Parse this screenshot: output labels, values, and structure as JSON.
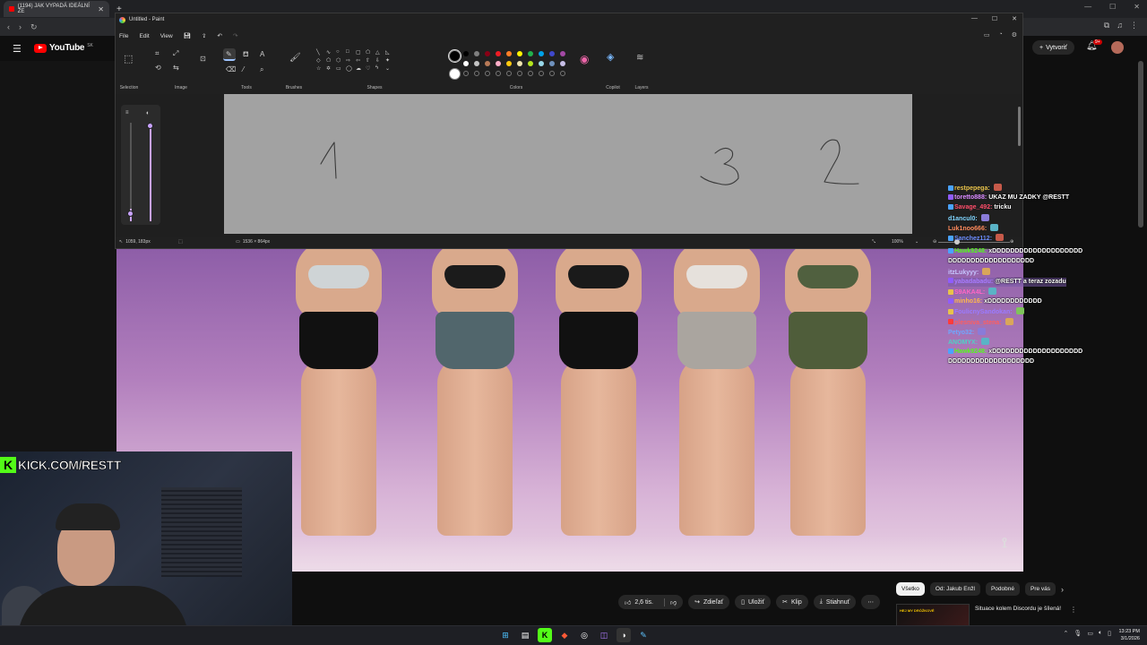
{
  "browser": {
    "tab_title": "(1194) JAK VYPADÁ IDEÁLNÍ ŽE",
    "tab_close": "✕",
    "new_tab": "+"
  },
  "youtube": {
    "logo_text": "YouTube",
    "region": "SK",
    "create_label": "Vytvoriť",
    "notif_count": "9+",
    "actions": {
      "like_count": "2,6 tis.",
      "share": "Zdieľať",
      "save": "Uložiť",
      "clip": "Klip",
      "download": "Stiahnuť"
    },
    "chips": [
      "Všetko",
      "Od: Jakub Enžl",
      "Podobné",
      "Pre vás"
    ],
    "recommended": {
      "thumb_text": "HEJ MY DRÓŽKOVÉ",
      "title": "Situace kolem Discordu je šílená!"
    }
  },
  "webcam": {
    "kick_label": "KICK.COM/RESTT"
  },
  "paint": {
    "window_title": "Untitled - Paint",
    "menu": [
      "File",
      "Edit",
      "View"
    ],
    "ribbon_groups": {
      "selection": "Selection",
      "image": "Image",
      "tools": "Tools",
      "brushes": "Brushes",
      "shapes": "Shapes",
      "colors": "Colors",
      "copilot": "Copilot",
      "layers": "Layers"
    },
    "colors": {
      "primary": "#000000",
      "secondary": "#ffffff",
      "palette_row1": [
        "#000000",
        "#7f7f7f",
        "#880015",
        "#ed1c24",
        "#ff7f27",
        "#fff200",
        "#22b14c",
        "#00a2e8",
        "#3f48cc",
        "#a349a4"
      ],
      "palette_row2": [
        "#ffffff",
        "#c3c3c3",
        "#b97a57",
        "#ffaec9",
        "#ffc90e",
        "#efe4b0",
        "#b5e61d",
        "#99d9ea",
        "#7092be",
        "#c8bfe7"
      ]
    },
    "canvas_numbers": [
      "1",
      "3",
      "2"
    ],
    "status": {
      "cursor_pos": "1059, 183px",
      "canvas_size": "1536 × 864px",
      "zoom": "100%"
    }
  },
  "chat": [
    {
      "user": "restpepega:",
      "user_color": "#e8c24a",
      "text": "",
      "badge": "#4aa3ff"
    },
    {
      "user": "toretto888:",
      "user_color": "#d98aff",
      "text": "UKAZ MU ZADKY @RESTT",
      "badge": "#8f5cff"
    },
    {
      "user": "Savage_492:",
      "user_color": "#ff4d6a",
      "text": "tricku",
      "badge": "#4aa3ff"
    },
    {
      "user": "d1ancul0:",
      "user_color": "#7fd4ff",
      "text": "",
      "badge": ""
    },
    {
      "user": "Luk1noo666:",
      "user_color": "#ff8a5c",
      "text": "",
      "badge": ""
    },
    {
      "user": "Sanchez112:",
      "user_color": "#6b8cff",
      "text": "",
      "badge": "#4aa3ff"
    },
    {
      "user": "Hawk9248:",
      "user_color": "#53fc18",
      "text": "xDDDDDDDDDDDDDDDDDDDD",
      "text2": "DDDDDDDDDDDDDDDDDDD",
      "badge": "#4aa3ff"
    },
    {
      "user": "itzLukyyy:",
      "user_color": "#c6c6ff",
      "text": "",
      "badge": ""
    },
    {
      "user": "yabadabadu:",
      "user_color": "#a77bff",
      "text": "@RESTT a teraz zozadu",
      "badge": "#8f5cff"
    },
    {
      "user": "S9AKA4L:",
      "user_color": "#ff66c4",
      "text": "",
      "badge": "#e8c24a"
    },
    {
      "user": "minho16:",
      "user_color": "#ffb84d",
      "text": "xDDDDDDDDDDDD",
      "badge": "#8f5cff"
    },
    {
      "user": "FoulicnySandokan:",
      "user_color": "#9a7bff",
      "text": "",
      "badge": "#e8c24a"
    },
    {
      "user": "plesniva_stena:",
      "user_color": "#ff5e5e",
      "text": "",
      "badge": "#ff3b3b"
    },
    {
      "user": "Petyo32:",
      "user_color": "#6ea8ff",
      "text": "",
      "badge": ""
    },
    {
      "user": "ANOMYX:",
      "user_color": "#4fd1c5",
      "text": "",
      "badge": ""
    },
    {
      "user": "Hawk9248:",
      "user_color": "#53fc18",
      "text": "xDDDDDDDDDDDDDDDDDDDD",
      "text2": "DDDDDDDDDDDDDDDDDDD",
      "badge": "#4aa3ff"
    }
  ],
  "taskbar": {
    "time": "13:23 PM",
    "date": "3/1/2026"
  }
}
